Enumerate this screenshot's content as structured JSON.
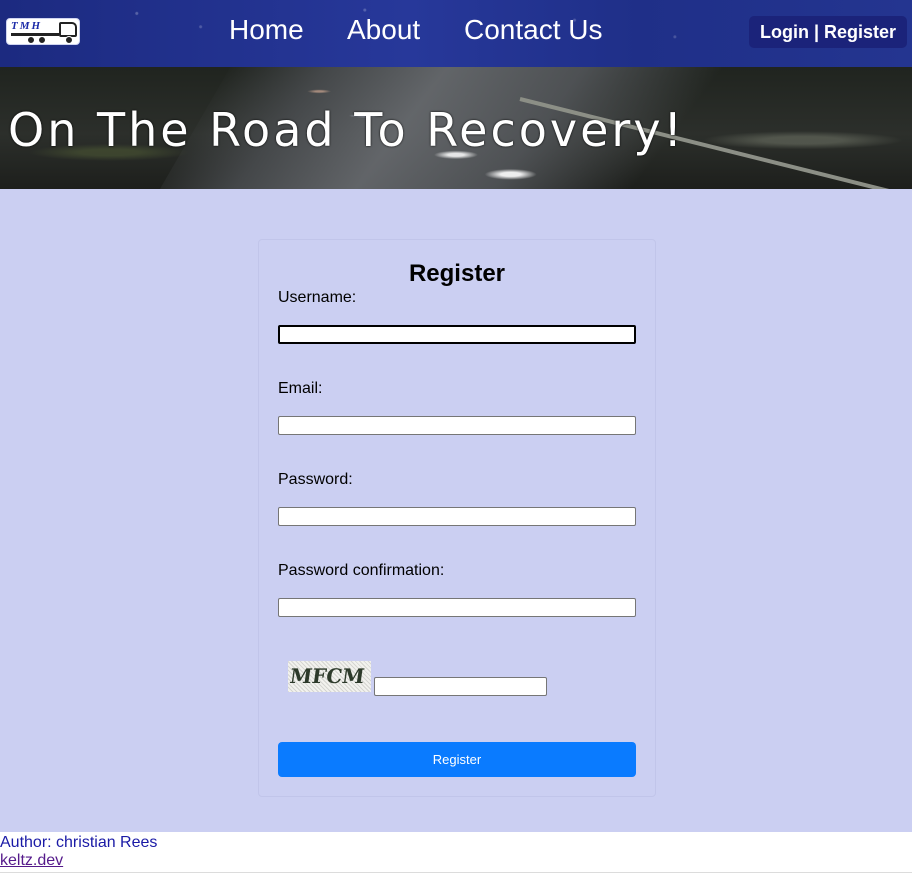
{
  "nav": {
    "logo_text": "TMH",
    "links": [
      {
        "label": "Home"
      },
      {
        "label": "About"
      },
      {
        "label": "Contact Us"
      }
    ],
    "auth": {
      "login": "Login",
      "separator": "|",
      "register": "Register"
    }
  },
  "hero": {
    "title": "On The Road To Recovery!"
  },
  "form": {
    "title": "Register",
    "fields": [
      {
        "label": "Username:",
        "value": ""
      },
      {
        "label": "Email:",
        "value": ""
      },
      {
        "label": "Password:",
        "value": ""
      },
      {
        "label": "Password confirmation:",
        "value": ""
      }
    ],
    "captcha": {
      "image_text": "MFCM",
      "value": ""
    },
    "submit_label": "Register"
  },
  "footer": {
    "author": "Author: christian Rees",
    "site": "keltz.dev"
  },
  "colors": {
    "nav_bg": "#1f2f88",
    "main_bg": "#cbcff2",
    "button": "#0a7bff",
    "auth_bg": "#1b237a"
  }
}
